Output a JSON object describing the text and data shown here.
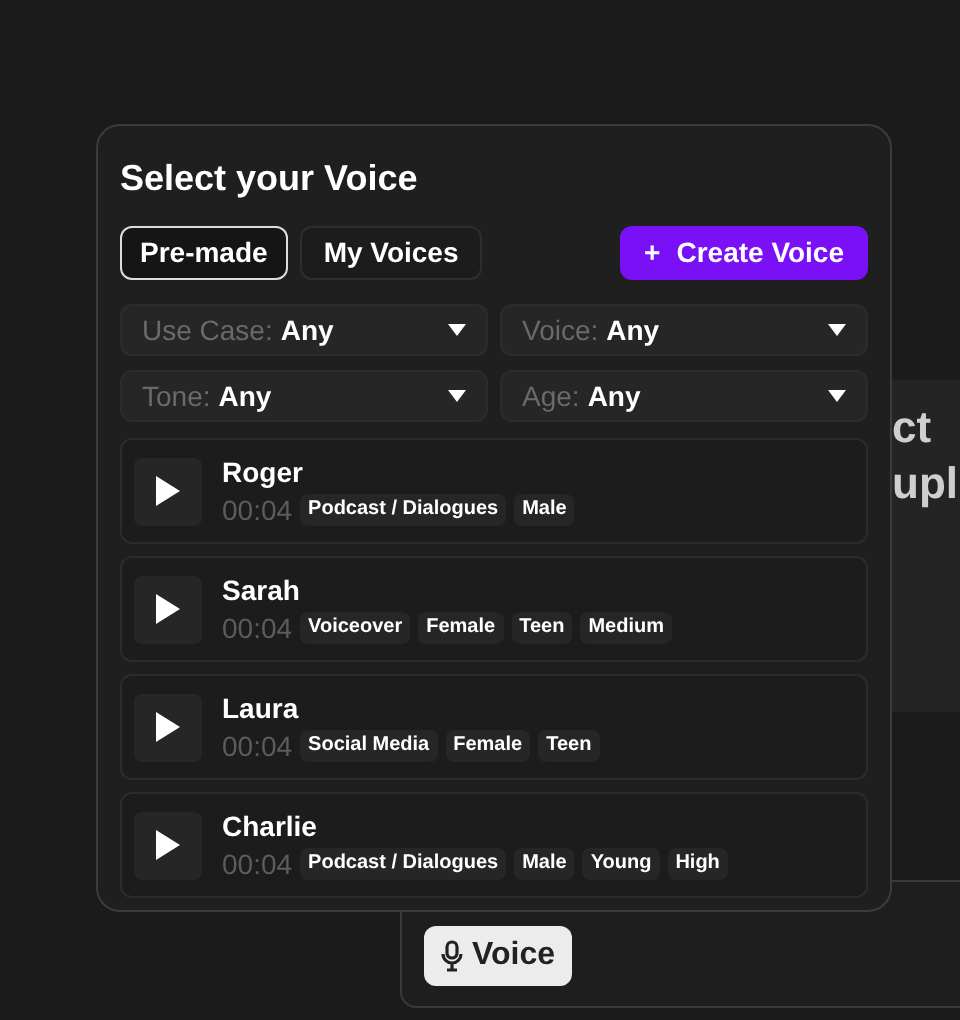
{
  "background_text": [
    "ct",
    "upl"
  ],
  "popup": {
    "title": "Select your Voice",
    "tabs": [
      {
        "label": "Pre-made",
        "selected": true
      },
      {
        "label": "My Voices",
        "selected": false
      }
    ],
    "create_button": {
      "icon": "+",
      "label": "Create Voice"
    },
    "filters": [
      {
        "label": "Use Case:",
        "value": "Any"
      },
      {
        "label": "Voice:",
        "value": "Any"
      },
      {
        "label": "Tone:",
        "value": "Any"
      },
      {
        "label": "Age:",
        "value": "Any"
      }
    ],
    "voices": [
      {
        "name": "Roger",
        "duration": "00:04",
        "tags": [
          "Podcast / Dialogues",
          "Male"
        ]
      },
      {
        "name": "Sarah",
        "duration": "00:04",
        "tags": [
          "Voiceover",
          "Female",
          "Teen",
          "Medium"
        ]
      },
      {
        "name": "Laura",
        "duration": "00:04",
        "tags": [
          "Social Media",
          "Female",
          "Teen"
        ]
      },
      {
        "name": "Charlie",
        "duration": "00:04",
        "tags": [
          "Podcast / Dialogues",
          "Male",
          "Young",
          "High"
        ]
      }
    ]
  },
  "voice_button": {
    "label": "Voice"
  }
}
